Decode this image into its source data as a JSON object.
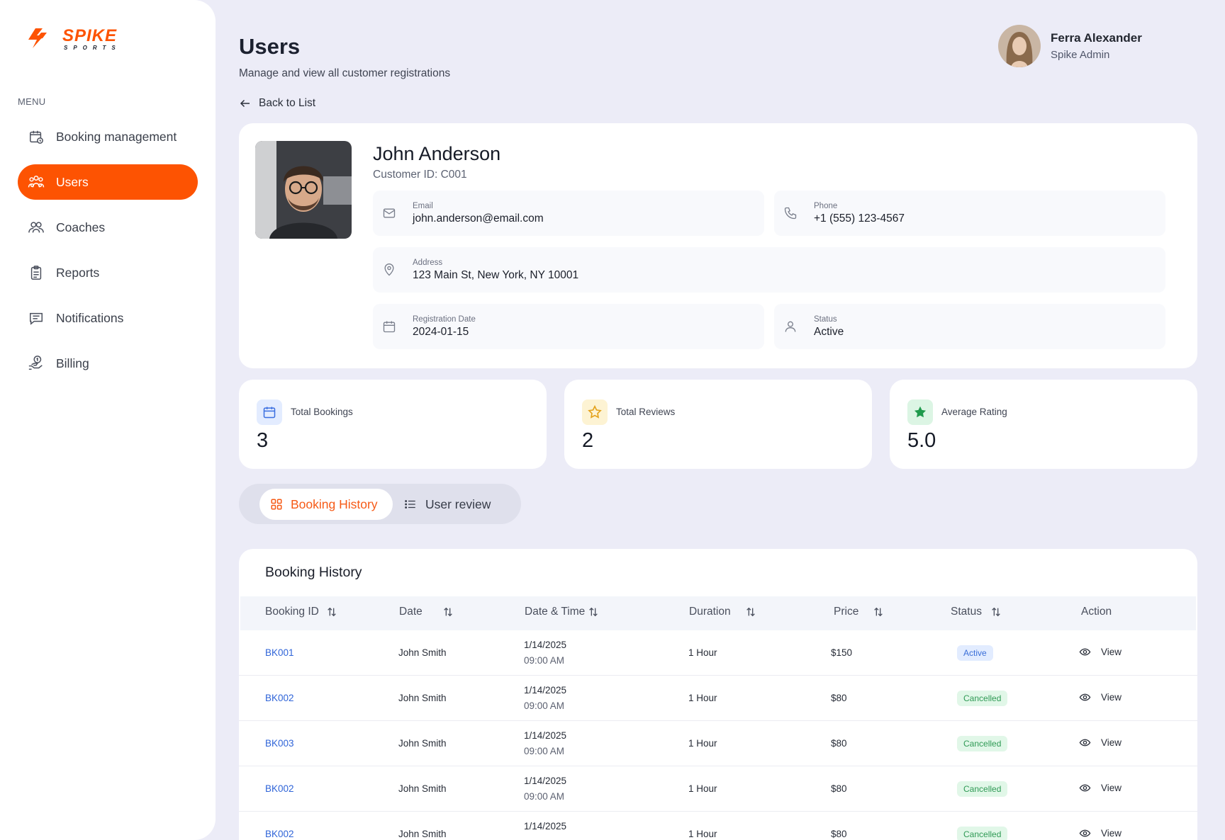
{
  "brand": {
    "name": "SPIKE",
    "tagline": "SPORTS",
    "accent": "#fd5302"
  },
  "sidebar": {
    "menu_label": "MENU",
    "items": [
      {
        "label": "Booking management",
        "icon": "calendar-icon"
      },
      {
        "label": "Users",
        "icon": "users-icon",
        "active": true
      },
      {
        "label": "Coaches",
        "icon": "coaches-icon"
      },
      {
        "label": "Reports",
        "icon": "clipboard-icon"
      },
      {
        "label": "Notifications",
        "icon": "message-icon"
      },
      {
        "label": "Billing",
        "icon": "billing-icon"
      }
    ]
  },
  "header": {
    "title": "Users",
    "subtitle": "Manage and view all customer registrations",
    "back_label": "Back to List"
  },
  "profile": {
    "name": "Ferra Alexander",
    "role": "Spike Admin"
  },
  "customer": {
    "name": "John Anderson",
    "customer_id": "Customer ID: C001",
    "email_label": "Email",
    "email": "john.anderson@email.com",
    "phone_label": "Phone",
    "phone": "+1 (555) 123-4567",
    "address_label": "Address",
    "address": "123 Main St, New York, NY 10001",
    "reg_label": "Registration Date",
    "reg_date": "2024-01-15",
    "status_label": "Status",
    "status": "Active"
  },
  "stats": [
    {
      "label": "Total Bookings",
      "value": "3",
      "icon": "calendar-icon",
      "color": "#3b6fe0"
    },
    {
      "label": "Total Reviews",
      "value": "2",
      "icon": "star-outline-icon",
      "color": "#e4a21b"
    },
    {
      "label": "Average Rating",
      "value": "5.0",
      "icon": "star-filled-icon",
      "color": "#1f9a4c"
    }
  ],
  "tabs": {
    "booking_history": "Booking History",
    "user_review": "User review"
  },
  "table": {
    "title": "Booking History",
    "headers": {
      "id": "Booking ID",
      "date": "Date",
      "datetime": "Date & Time",
      "duration": "Duration",
      "price": "Price",
      "status": "Status",
      "action": "Action"
    },
    "rows": [
      {
        "id": "BK001",
        "name": "John Smith",
        "date": "1/14/2025",
        "time": "09:00 AM",
        "duration": "1 Hour",
        "price": "$150",
        "status": "Active",
        "action": "View"
      },
      {
        "id": "BK002",
        "name": "John Smith",
        "date": "1/14/2025",
        "time": "09:00 AM",
        "duration": "1 Hour",
        "price": "$80",
        "status": "Cancelled",
        "action": "View"
      },
      {
        "id": "BK003",
        "name": "John Smith",
        "date": "1/14/2025",
        "time": "09:00 AM",
        "duration": "1 Hour",
        "price": "$80",
        "status": "Cancelled",
        "action": "View"
      },
      {
        "id": "BK002",
        "name": "John Smith",
        "date": "1/14/2025",
        "time": "09:00 AM",
        "duration": "1 Hour",
        "price": "$80",
        "status": "Cancelled",
        "action": "View"
      },
      {
        "id": "BK002",
        "name": "John Smith",
        "date": "1/14/2025",
        "time": "",
        "duration": "1 Hour",
        "price": "$80",
        "status": "Cancelled",
        "action": "View"
      }
    ]
  }
}
